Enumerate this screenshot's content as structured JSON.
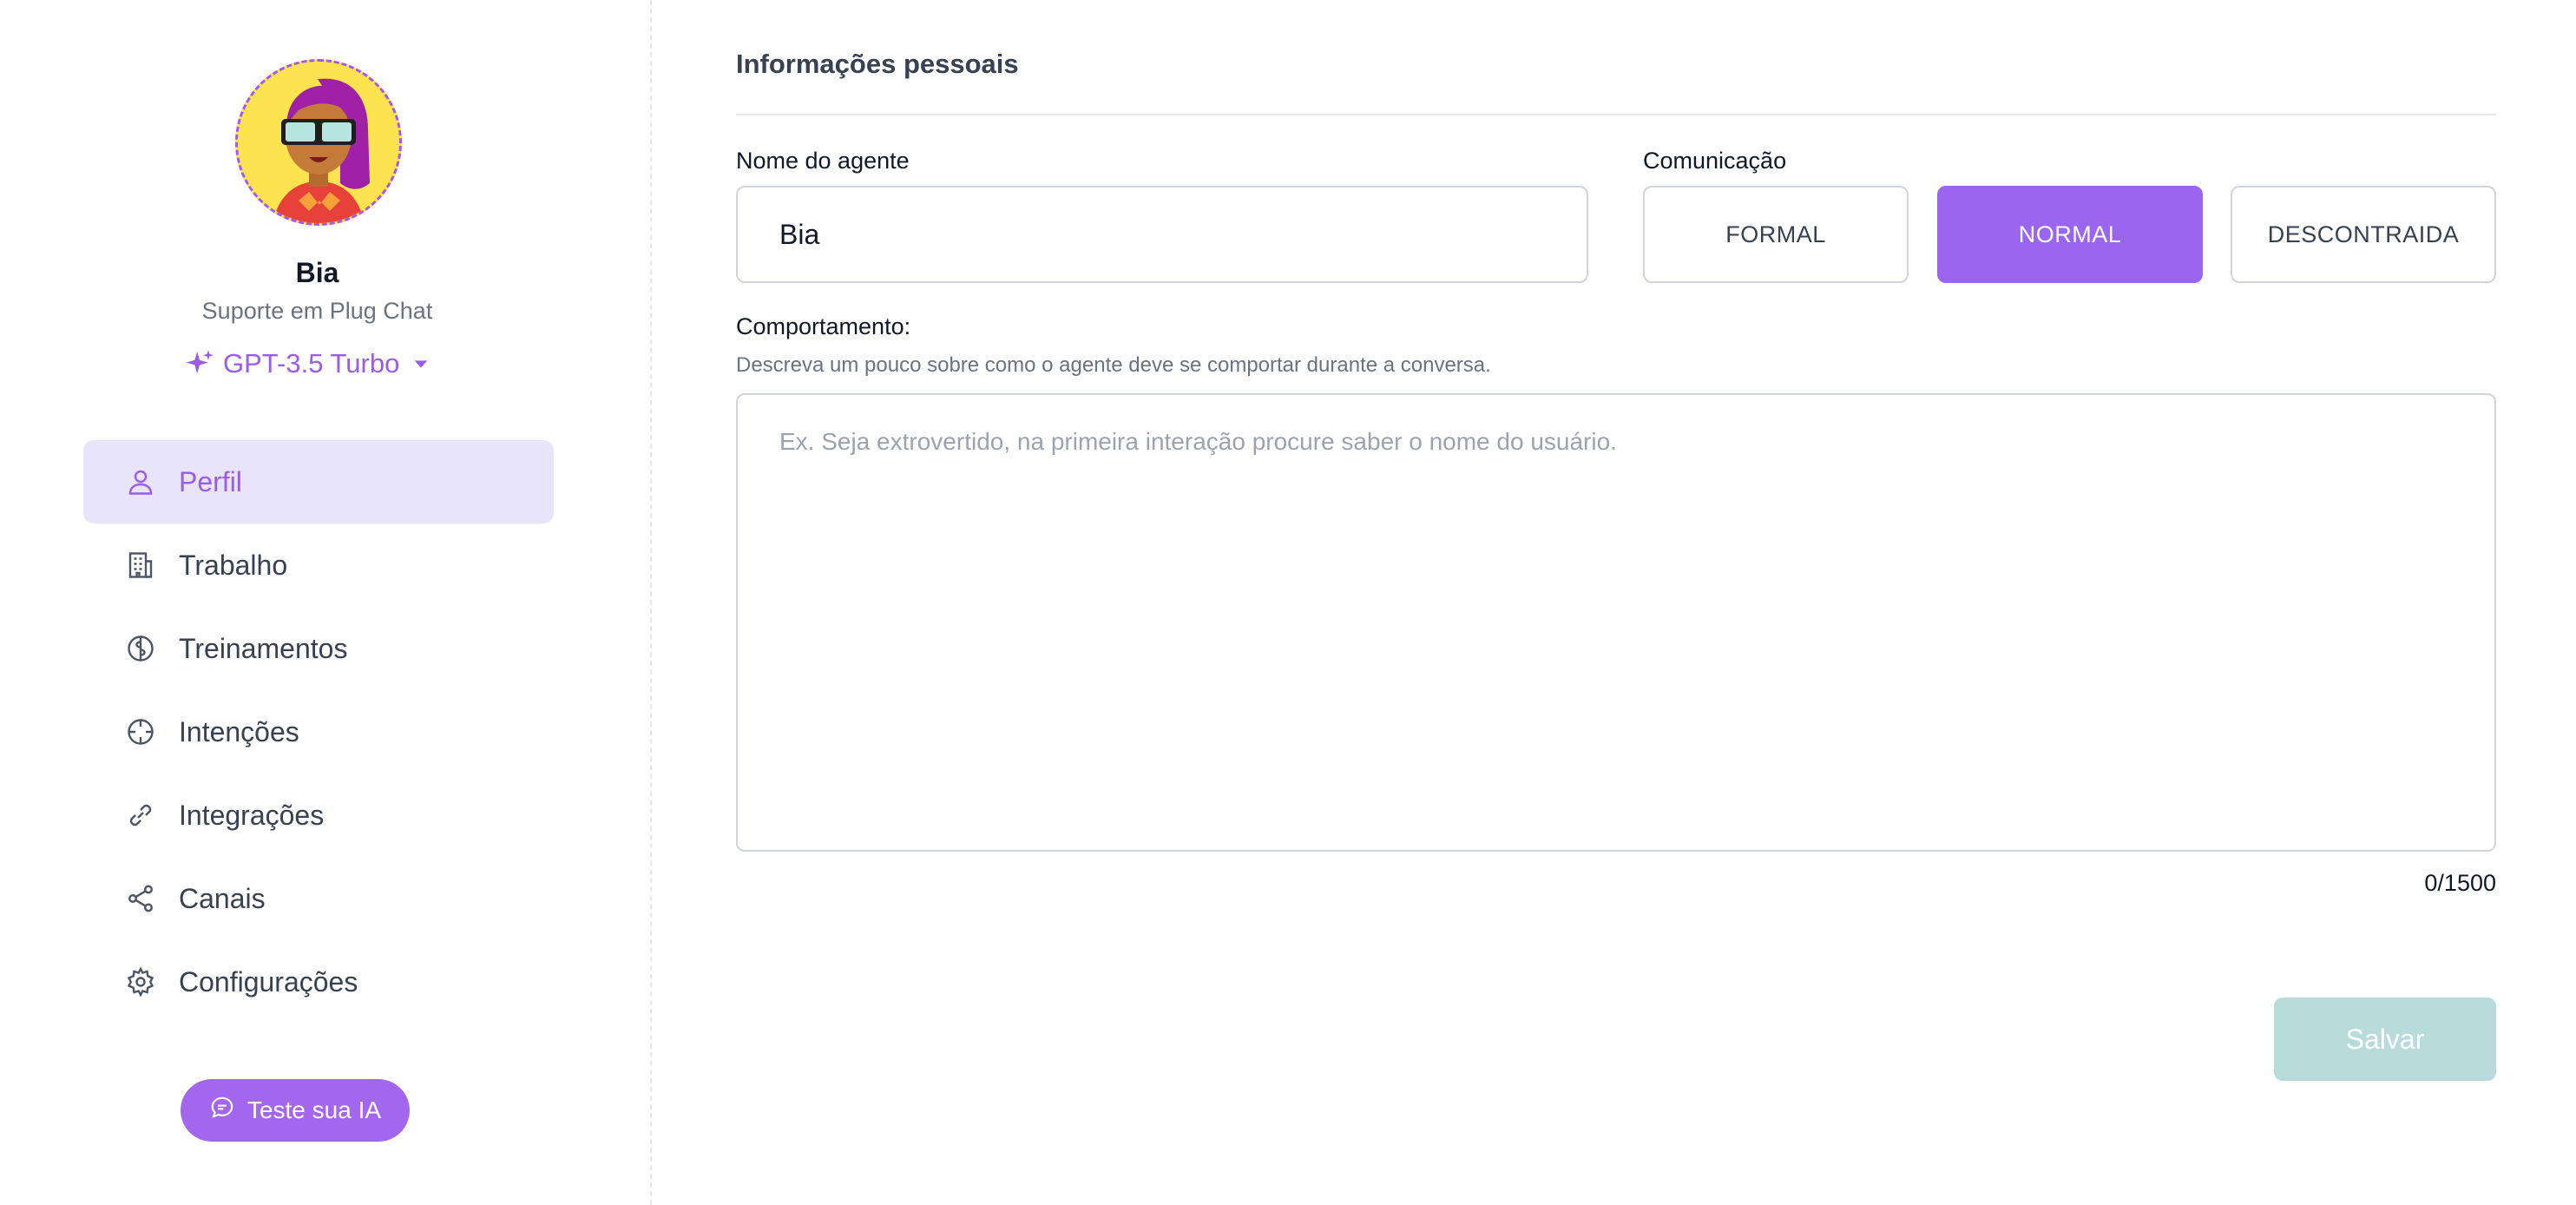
{
  "agent": {
    "name": "Bia",
    "subtitle": "Suporte em Plug Chat",
    "model": "GPT-3.5 Turbo"
  },
  "sidebar": {
    "items": [
      {
        "label": "Perfil",
        "icon": "user-icon",
        "active": true
      },
      {
        "label": "Trabalho",
        "icon": "building-icon",
        "active": false
      },
      {
        "label": "Treinamentos",
        "icon": "brain-icon",
        "active": false
      },
      {
        "label": "Intenções",
        "icon": "crosshair-icon",
        "active": false
      },
      {
        "label": "Integrações",
        "icon": "link-icon",
        "active": false
      },
      {
        "label": "Canais",
        "icon": "share-icon",
        "active": false
      },
      {
        "label": "Configurações",
        "icon": "gear-icon",
        "active": false
      }
    ],
    "test_button": "Teste sua IA"
  },
  "main": {
    "section_title": "Informações pessoais",
    "name_label": "Nome do agente",
    "name_value": "Bia",
    "communication_label": "Comunicação",
    "communication_options": [
      "FORMAL",
      "NORMAL",
      "DESCONTRAIDA"
    ],
    "communication_selected": "NORMAL",
    "behavior_label": "Comportamento:",
    "behavior_hint": "Descreva um pouco sobre como o agente deve se comportar durante a conversa.",
    "behavior_placeholder": "Ex. Seja extrovertido, na primeira interação procure saber o nome do usuário.",
    "counter": "0/1500",
    "save_label": "Salvar"
  },
  "colors": {
    "accent": "#9b5de5",
    "active_nav_bg": "#e8e4fa",
    "save_disabled": "#b8dcdc"
  }
}
